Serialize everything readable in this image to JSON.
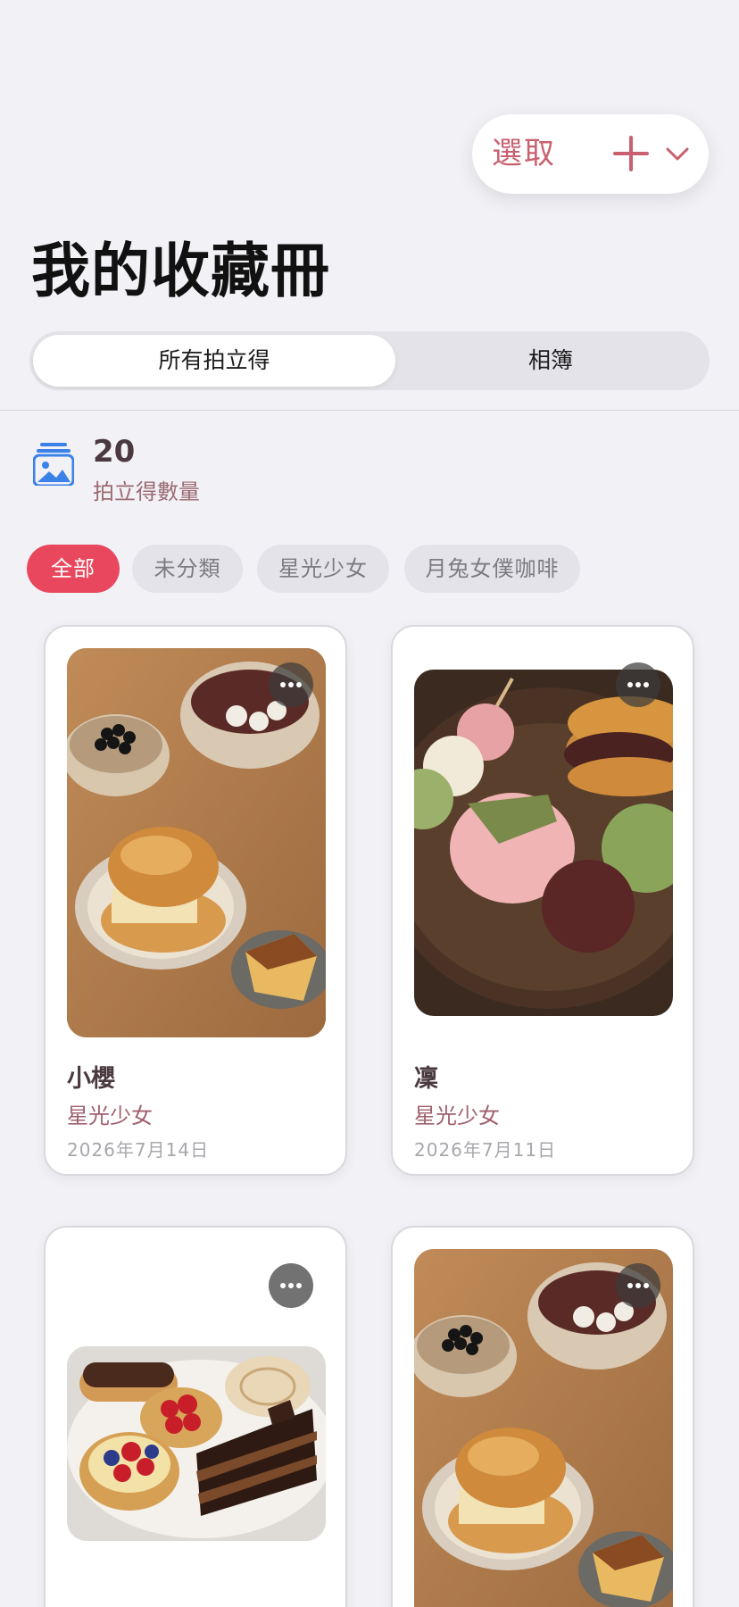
{
  "top_actions": {
    "select_label": "選取"
  },
  "page_title": "我的收藏冊",
  "segmented": {
    "tabs": [
      "所有拍立得",
      "相簿"
    ],
    "active_index": 0
  },
  "stats": {
    "count": "20",
    "label": "拍立得數量"
  },
  "filters": [
    {
      "label": "全部",
      "active": true
    },
    {
      "label": "未分類",
      "active": false
    },
    {
      "label": "星光少女",
      "active": false
    },
    {
      "label": "月兔女僕咖啡",
      "active": false
    }
  ],
  "cards": [
    {
      "name": "小櫻",
      "category": "星光少女",
      "date": "2026年7月14日",
      "photo": "taiwanese-dessert-spread"
    },
    {
      "name": "凜",
      "category": "星光少女",
      "date": "2026年7月11日",
      "photo": "japanese-wagashi-plate"
    },
    {
      "name": "",
      "category": "",
      "date": "",
      "photo": "french-pastry-plate"
    },
    {
      "name": "",
      "category": "",
      "date": "",
      "photo": "taiwanese-dessert-spread"
    }
  ],
  "colors": {
    "accent": "#e8475d",
    "accent_text": "#c9606f",
    "background": "#f2f1f6",
    "chip_inactive": "#e4e3e9",
    "stats_icon": "#3b82e8"
  }
}
